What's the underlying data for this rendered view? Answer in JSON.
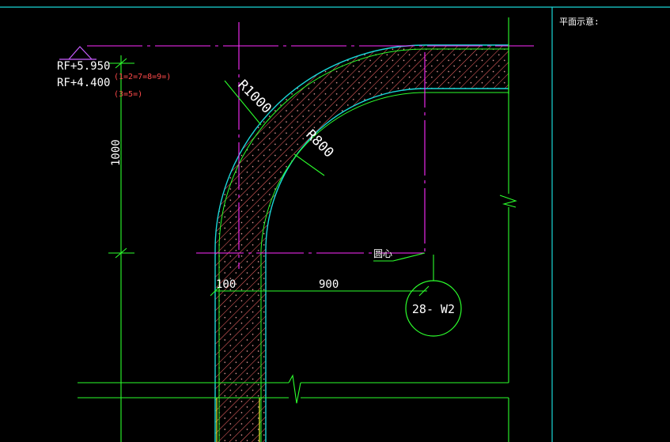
{
  "labels": {
    "rf_upper": "RF+5.950",
    "rf_lower": "RF+4.400",
    "floors_upper": "(1=2=7=8=9=)",
    "floors_lower": "(3=5=)",
    "height_dim": "1000",
    "outer_radius": "R1000",
    "inner_radius": "R800",
    "center_note": "圆心",
    "wall_thickness": "100",
    "offset_dim": "900",
    "detail_ref": "28- W2",
    "panel_title": "平面示意:"
  },
  "colors": {
    "background": "#000000",
    "frame": "#19d7d7",
    "wall_outline": "#2cff2c",
    "wall_inner": "#d7ff2c",
    "axis_line": "#ff2cff",
    "hatch": "#ff6a6a",
    "dim_line": "#2cff2c",
    "text": "#ffffff",
    "note_text": "#ff4a4a",
    "elevation_symbol": "#c95cff",
    "frame_cyan": "#19d7d7"
  }
}
